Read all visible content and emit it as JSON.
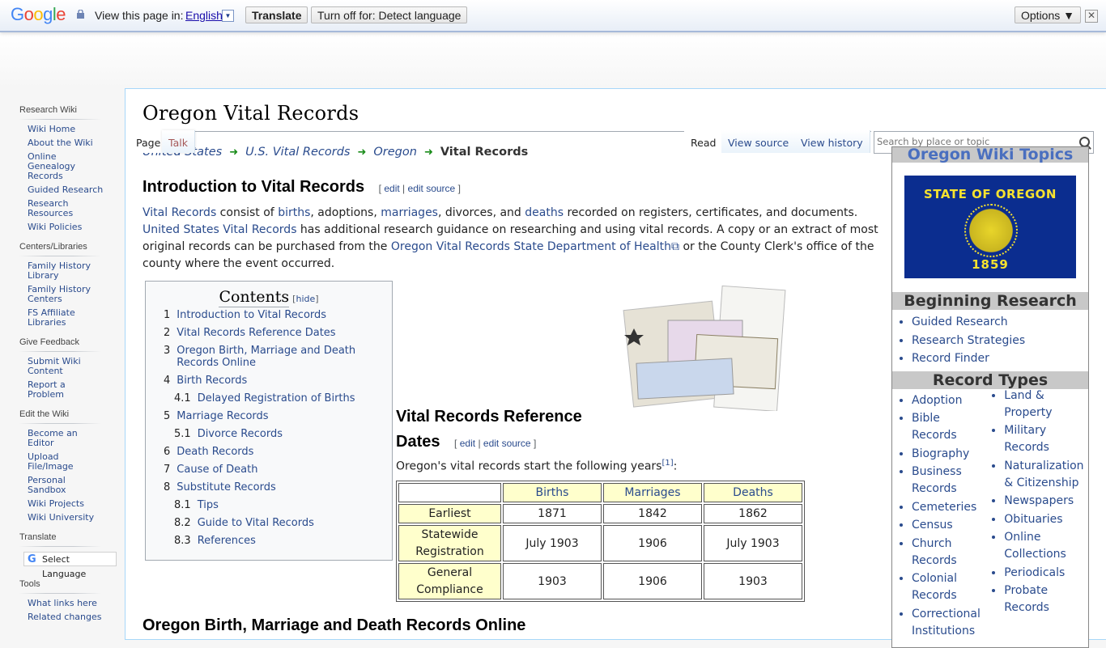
{
  "translate_bar": {
    "logo": "Google",
    "view_label": "View this page in:",
    "language": "English",
    "translate_button": "Translate",
    "turn_off_button": "Turn off for: Detect language",
    "options_button": "Options ▼",
    "close_icon": "✕"
  },
  "sidebar": {
    "sections": [
      {
        "title": "Research Wiki",
        "items": [
          "Wiki Home",
          "About the Wiki",
          "Online Genealogy Records",
          "Guided Research",
          "Research Resources",
          "Wiki Policies"
        ]
      },
      {
        "title": "Centers/Libraries",
        "items": [
          "Family History Library",
          "Family History Centers",
          "FS Affiliate Libraries"
        ]
      },
      {
        "title": "Give Feedback",
        "items": [
          "Submit Wiki Content",
          "Report a Problem"
        ]
      },
      {
        "title": "Edit the Wiki",
        "items": [
          "Become an Editor",
          "Upload File/Image",
          "Personal Sandbox",
          "Wiki Projects",
          "Wiki University"
        ]
      },
      {
        "title": "Translate",
        "select_language": "Select Language"
      },
      {
        "title": "Tools",
        "items": [
          "What links here",
          "Related changes"
        ]
      }
    ]
  },
  "tabs": {
    "page": "Page",
    "talk": "Talk",
    "read": "Read",
    "view_source": "View source",
    "view_history": "View history"
  },
  "search": {
    "placeholder": "Search by place or topic"
  },
  "page_title": "Oregon Vital Records",
  "breadcrumb": [
    "United States",
    "U.S. Vital Records",
    "Oregon",
    "Vital Records"
  ],
  "edit_links": {
    "open": "[",
    "edit": "edit",
    "sep": "|",
    "edit_source": "edit source",
    "close": "]"
  },
  "intro": {
    "heading": "Introduction to Vital Records",
    "p": [
      {
        "link": "Vital Records"
      },
      {
        "text": " consist of "
      },
      {
        "link": "births"
      },
      {
        "text": ", adoptions, "
      },
      {
        "link": "marriages"
      },
      {
        "text": ", divorces, and "
      },
      {
        "link": "deaths"
      },
      {
        "text": " recorded on registers, certificates, and documents. "
      },
      {
        "link": "United States Vital Records"
      },
      {
        "text": " has additional research guidance on researching and using vital records. A copy or an extract of most original records can be purchased from the "
      },
      {
        "link": "Oregon Vital Records State Department of Health⧉"
      },
      {
        "text": " or the County Clerk's office of the county where the event occurred."
      }
    ]
  },
  "toc": {
    "title": "Contents",
    "hide": "hide",
    "items": [
      {
        "num": "1",
        "label": "Introduction to Vital Records",
        "level": 1
      },
      {
        "num": "2",
        "label": "Vital Records Reference Dates",
        "level": 1
      },
      {
        "num": "3",
        "label": "Oregon Birth, Marriage and Death Records Online",
        "level": 1
      },
      {
        "num": "4",
        "label": "Birth Records",
        "level": 1
      },
      {
        "num": "4.1",
        "label": "Delayed Registration of Births",
        "level": 2
      },
      {
        "num": "5",
        "label": "Marriage Records",
        "level": 1
      },
      {
        "num": "5.1",
        "label": "Divorce Records",
        "level": 2
      },
      {
        "num": "6",
        "label": "Death Records",
        "level": 1
      },
      {
        "num": "7",
        "label": "Cause of Death",
        "level": 1
      },
      {
        "num": "8",
        "label": "Substitute Records",
        "level": 1
      },
      {
        "num": "8.1",
        "label": "Tips",
        "level": 2
      },
      {
        "num": "8.2",
        "label": "Guide to Vital Records",
        "level": 2
      },
      {
        "num": "8.3",
        "label": "References",
        "level": 2
      }
    ]
  },
  "section2": {
    "heading_line1": "Vital Records Reference",
    "heading_line2": "Dates",
    "start_text": "Oregon's vital records start the following years",
    "footnote": "[1]",
    "start_suffix": ":"
  },
  "table": {
    "columns": [
      "Births",
      "Marriages",
      "Deaths"
    ],
    "rows": [
      {
        "label": "Earliest",
        "values": [
          "1871",
          "1842",
          "1862"
        ]
      },
      {
        "label": "Statewide Registration",
        "values": [
          "July 1903",
          "1906",
          "July 1903"
        ]
      },
      {
        "label": "General Compliance",
        "values": [
          "1903",
          "1906",
          "1903"
        ]
      }
    ]
  },
  "bottom_heading": "Oregon Birth, Marriage and Death Records Online",
  "infobox": {
    "title": "Oregon Wiki Topics",
    "flag": {
      "top_text": "STATE OF OREGON",
      "year": "1859"
    },
    "beginning_research": {
      "heading": "Beginning Research",
      "items": [
        "Guided Research",
        "Research Strategies",
        "Record Finder"
      ]
    },
    "record_types": {
      "heading": "Record Types",
      "col1": [
        "Adoption",
        "Bible Records",
        "Biography",
        "Business Records",
        "Cemeteries",
        "Census",
        "Church Records",
        "Colonial Records",
        "Correctional Institutions"
      ],
      "col2": [
        "Land & Property",
        "Military Records",
        "Naturalization & Citizenship",
        "Newspapers",
        "Obituaries",
        "Online Collections",
        "Periodicals",
        "Probate Records"
      ]
    }
  },
  "colors": {
    "link": "#2a4b8d",
    "table_header_bg": "#ffffcc",
    "infobox_header_bg": "#c8c8c8",
    "flag_blue": "#0b2d8f",
    "flag_gold": "#f6e22f",
    "breadcrumb_arrow": "#1a8c1a"
  }
}
